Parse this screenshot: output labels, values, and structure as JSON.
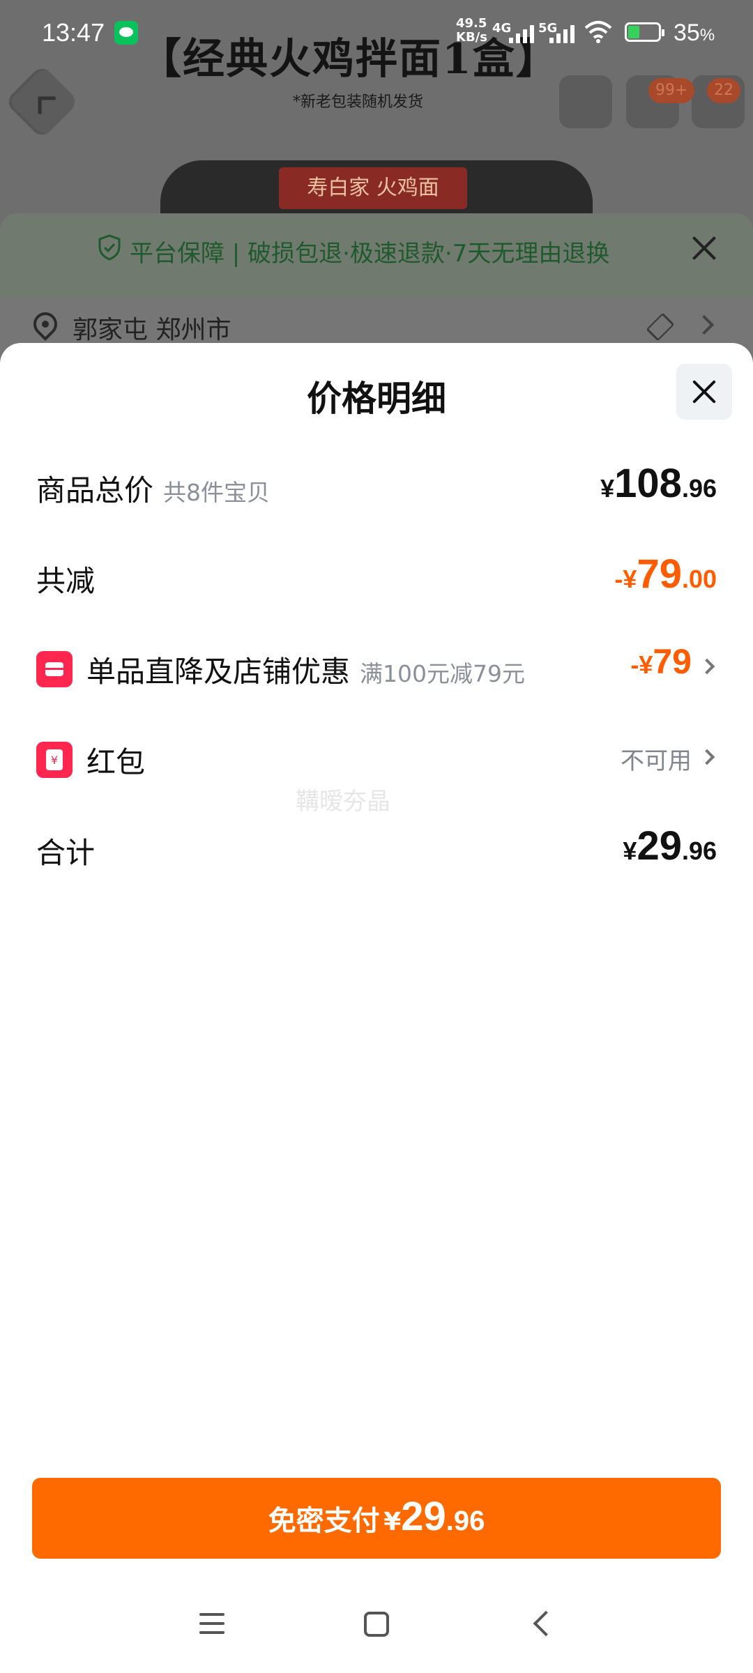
{
  "status_bar": {
    "time": "13:47",
    "net_speed_value": "49.5",
    "net_speed_unit": "KB/s",
    "signal_1": "4G",
    "signal_2": "5G",
    "battery_percent": "35",
    "battery_unit": "%"
  },
  "background": {
    "banner_title": "【经典火鸡拌面1盒】",
    "banner_subtitle": "*新老包装随机发货",
    "cart_badge": "99+",
    "msg_badge": "22",
    "product_label": "寿白家 火鸡面",
    "guarantee": "平台保障 | 破损包退·极速退款·7天无理由退换",
    "address": "郭家屯 郑州市"
  },
  "sheet": {
    "title": "价格明细",
    "rows": [
      {
        "label": "商品总价",
        "sub": "共8件宝贝",
        "yen": "¥",
        "int": "108",
        "dec": ".96"
      },
      {
        "label": "共减",
        "yen": "-¥",
        "int": "79",
        "dec": ".00"
      },
      {
        "label": "单品直降及店铺优惠",
        "sub": "满100元减79元",
        "yen": "-¥",
        "int": "79"
      },
      {
        "label": "红包",
        "value": "不可用"
      },
      {
        "label": "合计",
        "yen": "¥",
        "int": "29",
        "dec": ".96"
      }
    ],
    "watermark": "鞲暧夯晶",
    "pay": {
      "text": "免密支付",
      "yen": "¥",
      "int": "29",
      "dec": ".96"
    }
  },
  "colors": {
    "accent_orange": "#ff6a00",
    "discount_orange": "#ff5c00",
    "icon_red": "#ff2650"
  }
}
